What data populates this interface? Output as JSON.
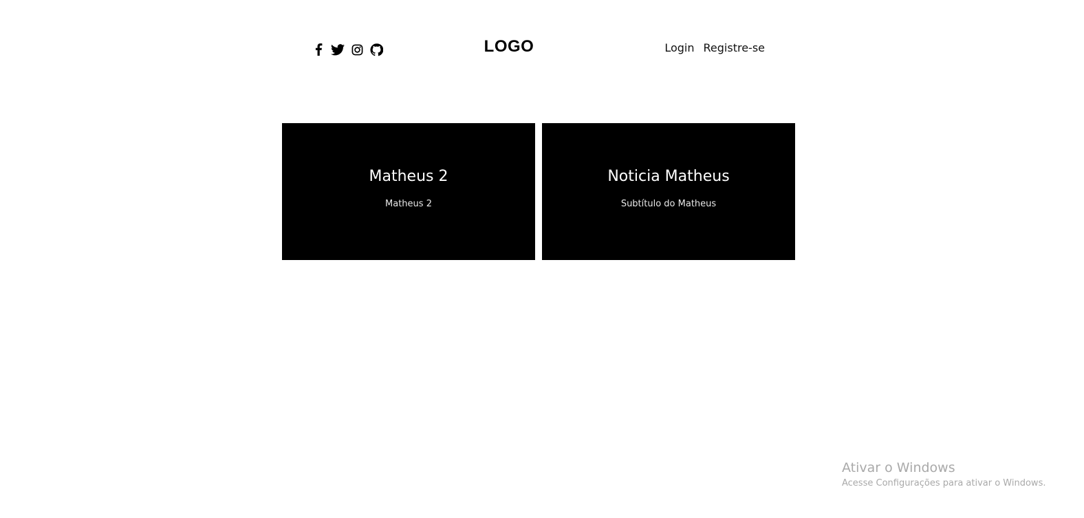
{
  "header": {
    "logo": "LOGO",
    "social_icons": [
      "facebook-icon",
      "twitter-icon",
      "instagram-icon",
      "github-icon"
    ],
    "login_label": "Login",
    "register_label": "Registre-se"
  },
  "cards": [
    {
      "title": "Matheus 2",
      "subtitle": "Matheus 2"
    },
    {
      "title": "Noticia Matheus",
      "subtitle": "Subtítulo do Matheus"
    }
  ],
  "watermark": {
    "title": "Ativar o Windows",
    "subtitle": "Acesse Configurações para ativar o Windows."
  },
  "colors": {
    "background": "#ffffff",
    "card_background": "#000000",
    "card_text": "#ffffff",
    "watermark_text": "#a9a9a9"
  }
}
